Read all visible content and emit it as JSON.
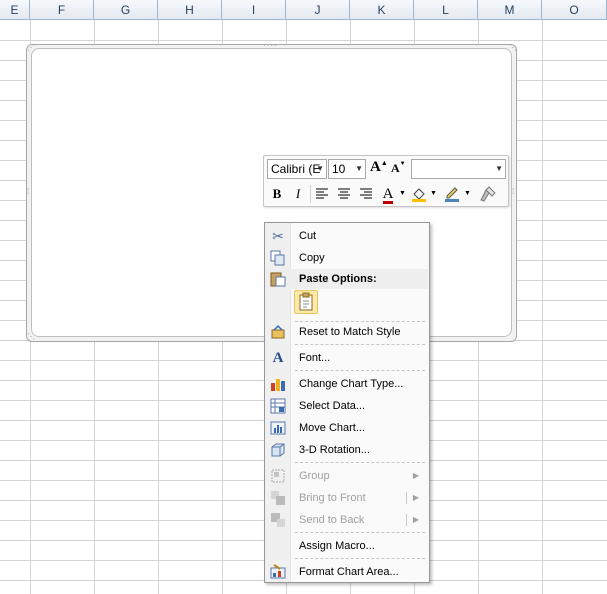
{
  "columns": [
    "E",
    "F",
    "G",
    "H",
    "I",
    "J",
    "K",
    "L",
    "M",
    "O"
  ],
  "mini_toolbar": {
    "font_name": "Calibri (E",
    "font_size": "10",
    "grow_font": "A",
    "shrink_font": "A",
    "style_box": "",
    "bold": "B",
    "italic": "I",
    "font_color_glyph": "A",
    "font_color": "#c00000",
    "fill_color": "#ffc000",
    "line_color": "#4f81bd"
  },
  "context_menu": {
    "items": [
      {
        "label": "Cut",
        "icon": "scissors-icon",
        "enabled": true
      },
      {
        "label": "Copy",
        "icon": "copy-icon",
        "enabled": true
      },
      {
        "label": "Paste Options:",
        "icon": "paste-icon",
        "enabled": true
      },
      {
        "label": "Reset to Match Style",
        "icon": "reset-style-icon",
        "enabled": true
      },
      {
        "label": "Font...",
        "icon": "font-icon",
        "enabled": true
      },
      {
        "label": "Change Chart Type...",
        "icon": "chart-type-icon",
        "enabled": true
      },
      {
        "label": "Select Data...",
        "icon": "select-data-icon",
        "enabled": true
      },
      {
        "label": "Move Chart...",
        "icon": "move-chart-icon",
        "enabled": true
      },
      {
        "label": "3-D Rotation...",
        "icon": "rotation-3d-icon",
        "enabled": true
      },
      {
        "label": "Group",
        "icon": "group-icon",
        "enabled": false
      },
      {
        "label": "Bring to Front",
        "icon": "bring-front-icon",
        "enabled": false
      },
      {
        "label": "Send to Back",
        "icon": "send-back-icon",
        "enabled": false
      },
      {
        "label": "Assign Macro...",
        "icon": "",
        "enabled": true
      },
      {
        "label": "Format Chart Area...",
        "icon": "format-chart-icon",
        "enabled": true
      }
    ]
  }
}
